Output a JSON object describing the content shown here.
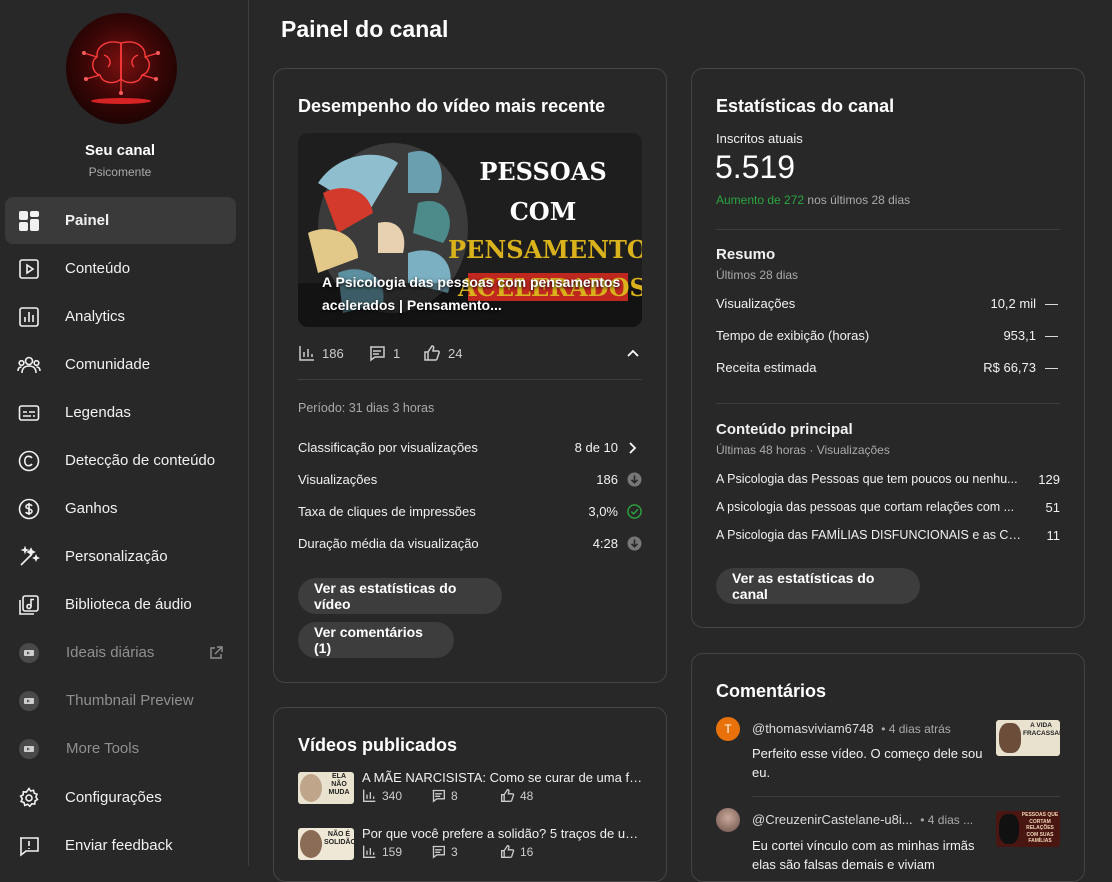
{
  "sidebar": {
    "channel_name": "Seu canal",
    "channel_handle": "Psicomente",
    "items": [
      {
        "label": "Painel",
        "icon": "dashboard-icon",
        "active": true
      },
      {
        "label": "Conteúdo",
        "icon": "content-icon"
      },
      {
        "label": "Analytics",
        "icon": "analytics-icon"
      },
      {
        "label": "Comunidade",
        "icon": "community-icon"
      },
      {
        "label": "Legendas",
        "icon": "subtitles-icon"
      },
      {
        "label": "Detecção de conteúdo",
        "icon": "copyright-icon"
      },
      {
        "label": "Ganhos",
        "icon": "earn-icon"
      },
      {
        "label": "Personalização",
        "icon": "customization-icon"
      },
      {
        "label": "Biblioteca de áudio",
        "icon": "audio-library-icon"
      },
      {
        "label": "Ideais diárias",
        "icon": "extension-icon",
        "dim": true,
        "external": true
      },
      {
        "label": "Thumbnail Preview",
        "icon": "extension-icon",
        "dim": true
      },
      {
        "label": "More Tools",
        "icon": "extension-icon",
        "dim": true
      },
      {
        "label": "Configurações",
        "icon": "settings-icon"
      },
      {
        "label": "Enviar feedback",
        "icon": "feedback-icon"
      }
    ]
  },
  "page_title": "Painel do canal",
  "latest_video": {
    "title": "Desempenho do vídeo mais recente",
    "thumb_line1": "PESSOAS",
    "thumb_line2": "COM",
    "thumb_line3": "PENSAMENTOS",
    "thumb_line4": "ACELERADOS",
    "caption": "A Psicologia das pessoas com pensamentos acelerados | Pensamento...",
    "views": "186",
    "comments": "1",
    "likes": "24",
    "period": "Período: 31 dias 3 horas",
    "rows": [
      {
        "label": "Classificação por visualizações",
        "value": "8 de 10"
      },
      {
        "label": "Visualizações",
        "value": "186"
      },
      {
        "label": "Taxa de cliques de impressões",
        "value": "3,0%"
      },
      {
        "label": "Duração média da visualização",
        "value": "4:28"
      }
    ],
    "btn_stats": "Ver as estatísticas do vídeo",
    "btn_comments": "Ver comentários (1)"
  },
  "published": {
    "title": "Vídeos publicados",
    "videos": [
      {
        "title": "A MÃE NARCISISTA: Como se curar de uma fa...",
        "views": "340",
        "comments": "8",
        "likes": "48",
        "thumb_text": "ELA NÃO MUDA"
      },
      {
        "title": "Por que você prefere a solidão? 5 traços de um...",
        "views": "159",
        "comments": "3",
        "likes": "16",
        "thumb_text": "NÃO É SOLIDÃO"
      }
    ]
  },
  "channel_stats": {
    "title": "Estatísticas do canal",
    "subs_label": "Inscritos atuais",
    "subs_value": "5.519",
    "subs_increase": "Aumento de 272",
    "subs_period": "nos últimos 28 dias",
    "summary_title": "Resumo",
    "summary_sub": "Últimos 28 dias",
    "summary_rows": [
      {
        "label": "Visualizações",
        "value": "10,2 mil",
        "trend": "—"
      },
      {
        "label": "Tempo de exibição (horas)",
        "value": "953,1",
        "trend": "—"
      },
      {
        "label": "Receita estimada",
        "value": "R$ 66,73",
        "trend": "—"
      }
    ],
    "top_title": "Conteúdo principal",
    "top_sub": "Últimas 48 horas · Visualizações",
    "top_rows": [
      {
        "label": "A Psicologia das Pessoas que tem poucos ou nenhu...",
        "value": "129"
      },
      {
        "label": "A psicologia das pessoas que cortam relações com ...",
        "value": "51"
      },
      {
        "label": "A Psicologia das FAMÍLIAS DISFUNCIONAIS e as CO...",
        "value": "11"
      }
    ],
    "btn": "Ver as estatísticas do canal"
  },
  "comments": {
    "title": "Comentários",
    "items": [
      {
        "author": "@thomasviviam6748",
        "time": "• 4 dias atrás",
        "text": "Perfeito esse vídeo. O começo dele sou eu.",
        "avatar_letter": "T",
        "avatar_color": "#e8710a",
        "thumb_text": "A VIDA FRACASSADA"
      },
      {
        "author": "@CreuzenirCastelane-u8i...",
        "time": "• 4 dias ...",
        "text": "Eu cortei vínculo com as minhas irmãs elas são falsas demais e viviam",
        "thumb_text": "PESSOAS QUE CORTAM RELAÇÕES COM SUAS FAMÍLIAS"
      }
    ]
  },
  "colors": {
    "green": "#2ba640",
    "bg": "#282828",
    "card_border": "#444444"
  }
}
